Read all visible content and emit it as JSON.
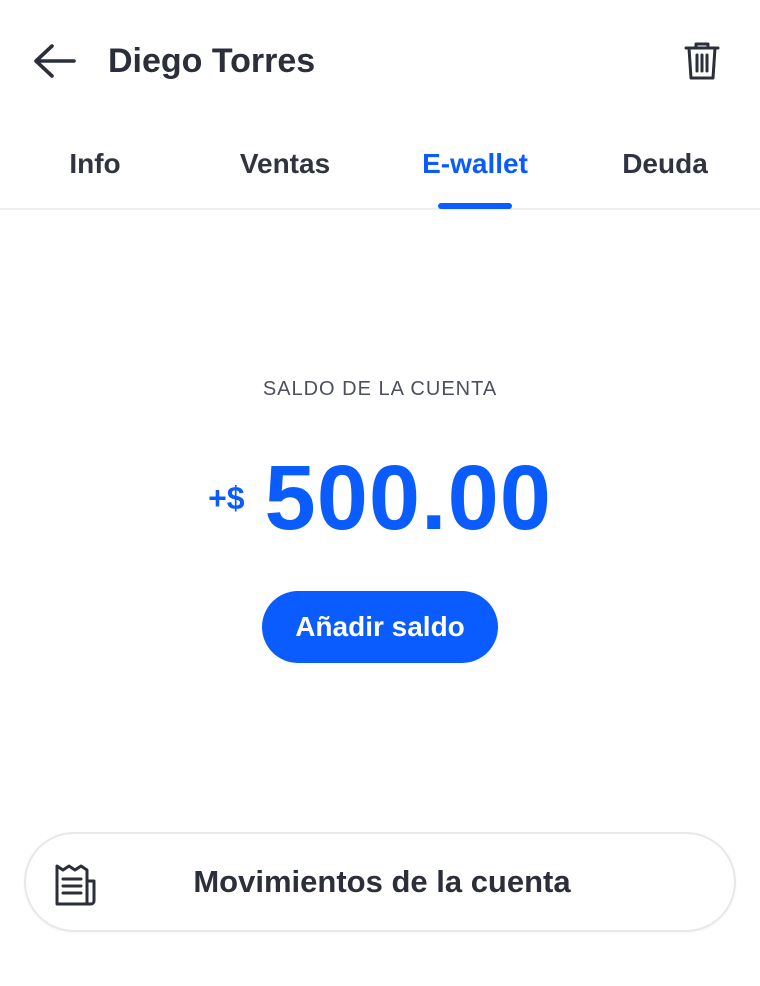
{
  "header": {
    "title": "Diego Torres",
    "back_icon": "arrow-left-icon",
    "delete_icon": "trash-icon"
  },
  "tabs": [
    {
      "label": "Info",
      "active": false
    },
    {
      "label": "Ventas",
      "active": false
    },
    {
      "label": "E-wallet",
      "active": true
    },
    {
      "label": "Deuda",
      "active": false
    }
  ],
  "wallet": {
    "balance_label": "SALDO DE LA CUENTA",
    "balance_prefix": "+$",
    "balance_amount": "500.00",
    "add_button_label": "Añadir saldo",
    "movements_label": "Movimientos de la cuenta",
    "movements_icon": "receipt-icon"
  },
  "colors": {
    "accent": "#0a5cff",
    "text": "#2b2f3a",
    "muted": "#4b505b",
    "divider": "#eceef1"
  }
}
